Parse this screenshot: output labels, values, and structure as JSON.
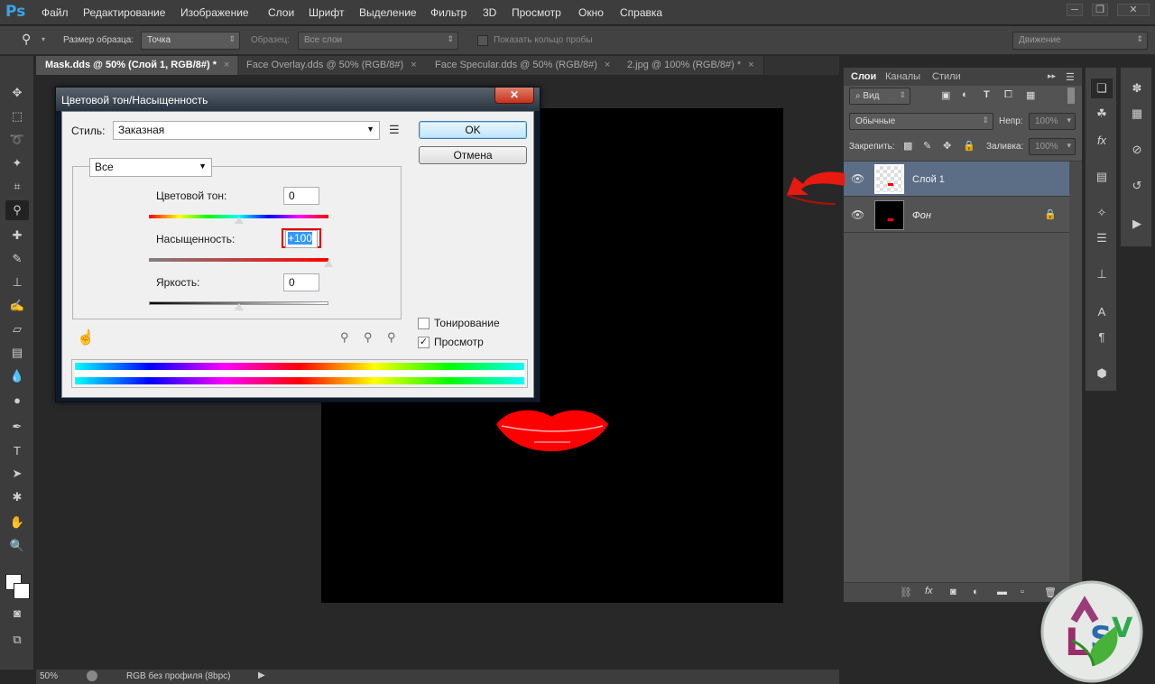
{
  "app": {
    "logo": "Ps"
  },
  "menu": [
    "Файл",
    "Редактирование",
    "Изображение",
    "Слои",
    "Шрифт",
    "Выделение",
    "Фильтр",
    "3D",
    "Просмотр",
    "Окно",
    "Справка"
  ],
  "window_buttons": {
    "minimize": "─",
    "restore": "❐",
    "close": "✕"
  },
  "options_bar": {
    "sample_size_label": "Размер образца:",
    "sample_size_value": "Точка",
    "sample_label": "Образец:",
    "sample_value": "Все слои",
    "show_ring_label": "Показать кольцо пробы",
    "workspace_value": "Движение"
  },
  "tabs": [
    {
      "label": "Mask.dds @ 50% (Слой 1, RGB/8#) *",
      "close": "×"
    },
    {
      "label": "Face Overlay.dds @ 50% (RGB/8#)",
      "close": "×"
    },
    {
      "label": "Face Specular.dds @ 50% (RGB/8#)",
      "close": "×"
    },
    {
      "label": "2.jpg @ 100% (RGB/8#) *",
      "close": "×"
    }
  ],
  "status_bar": {
    "zoom": "50%",
    "profile": "RGB без профиля (8bpc)"
  },
  "layers_panel": {
    "tabs": [
      "Слои",
      "Каналы",
      "Стили"
    ],
    "kind_filter": "Вид",
    "blend_mode": "Обычные",
    "opacity_label": "Непр:",
    "opacity_value": "100%",
    "lock_label": "Закрепить:",
    "fill_label": "Заливка:",
    "fill_value": "100%",
    "layers": [
      {
        "name": "Слой 1",
        "selected": true
      },
      {
        "name": "Фон",
        "selected": false
      }
    ]
  },
  "dialog": {
    "title": "Цветовой тон/Насыщенность",
    "close": "✕",
    "style_label": "Стиль:",
    "style_value": "Заказная",
    "channel_value": "Все",
    "ok_label": "OK",
    "cancel_label": "Отмена",
    "hue_label": "Цветовой тон:",
    "hue_value": "0",
    "saturation_label": "Насыщенность:",
    "saturation_value": "+100",
    "lightness_label": "Яркость:",
    "lightness_value": "0",
    "colorize_label": "Тонирование",
    "preview_label": "Просмотр",
    "colorize_checked": false,
    "preview_checked": true,
    "hue_level": 0,
    "saturation_level": 100,
    "lightness_level": 0
  },
  "colors": {
    "accent_red": "#ff0000",
    "selection_blue": "#5b6e86",
    "highlight_blue": "#3399ff"
  }
}
